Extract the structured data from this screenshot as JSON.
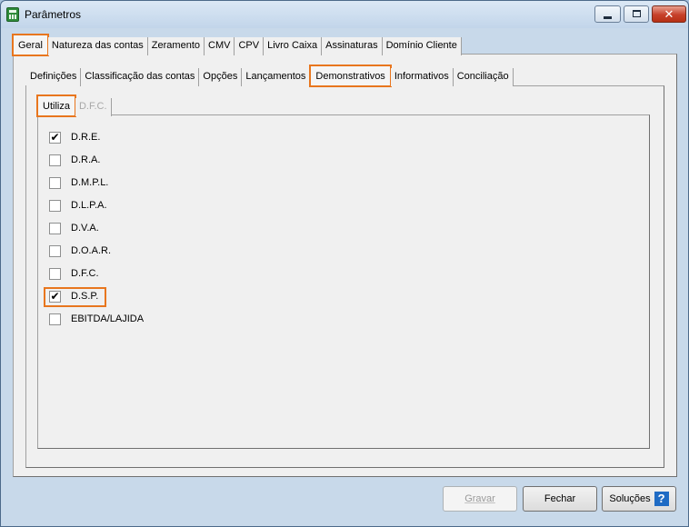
{
  "window": {
    "title": "Parâmetros",
    "close_glyph": "✕"
  },
  "main_tabs": [
    {
      "label": "Geral",
      "active": true
    },
    {
      "label": "Natureza das contas"
    },
    {
      "label": "Zeramento"
    },
    {
      "label": "CMV"
    },
    {
      "label": "CPV"
    },
    {
      "label": "Livro Caixa"
    },
    {
      "label": "Assinaturas"
    },
    {
      "label": "Domínio Cliente"
    }
  ],
  "sub_tabs": [
    {
      "label": "Definições"
    },
    {
      "label": "Classificação das contas"
    },
    {
      "label": "Opções"
    },
    {
      "label": "Lançamentos"
    },
    {
      "label": "Demonstrativos",
      "active": true
    },
    {
      "label": "Informativos"
    },
    {
      "label": "Conciliação"
    }
  ],
  "inner_tabs": [
    {
      "label": "Utiliza",
      "active": true
    },
    {
      "label": "D.F.C.",
      "disabled": true
    }
  ],
  "checklist": [
    {
      "label": "D.R.E.",
      "checked": true,
      "mark": "✔"
    },
    {
      "label": "D.R.A.",
      "checked": false,
      "mark": ""
    },
    {
      "label": "D.M.P.L.",
      "checked": false,
      "mark": ""
    },
    {
      "label": "D.L.P.A.",
      "checked": false,
      "mark": ""
    },
    {
      "label": "D.V.A.",
      "checked": false,
      "mark": ""
    },
    {
      "label": "D.O.A.R.",
      "checked": false,
      "mark": ""
    },
    {
      "label": "D.F.C.",
      "checked": false,
      "mark": ""
    },
    {
      "label": "D.S.P.",
      "checked": true,
      "mark": "✔"
    },
    {
      "label": "EBITDA/LAJIDA",
      "checked": false,
      "mark": ""
    }
  ],
  "footer": {
    "save_label": "Gravar",
    "close_label": "Fechar",
    "solutions_label": "Soluções",
    "help_glyph": "?"
  },
  "colors": {
    "highlight": "#e8761e",
    "help_icon": "#1f6bc4"
  }
}
